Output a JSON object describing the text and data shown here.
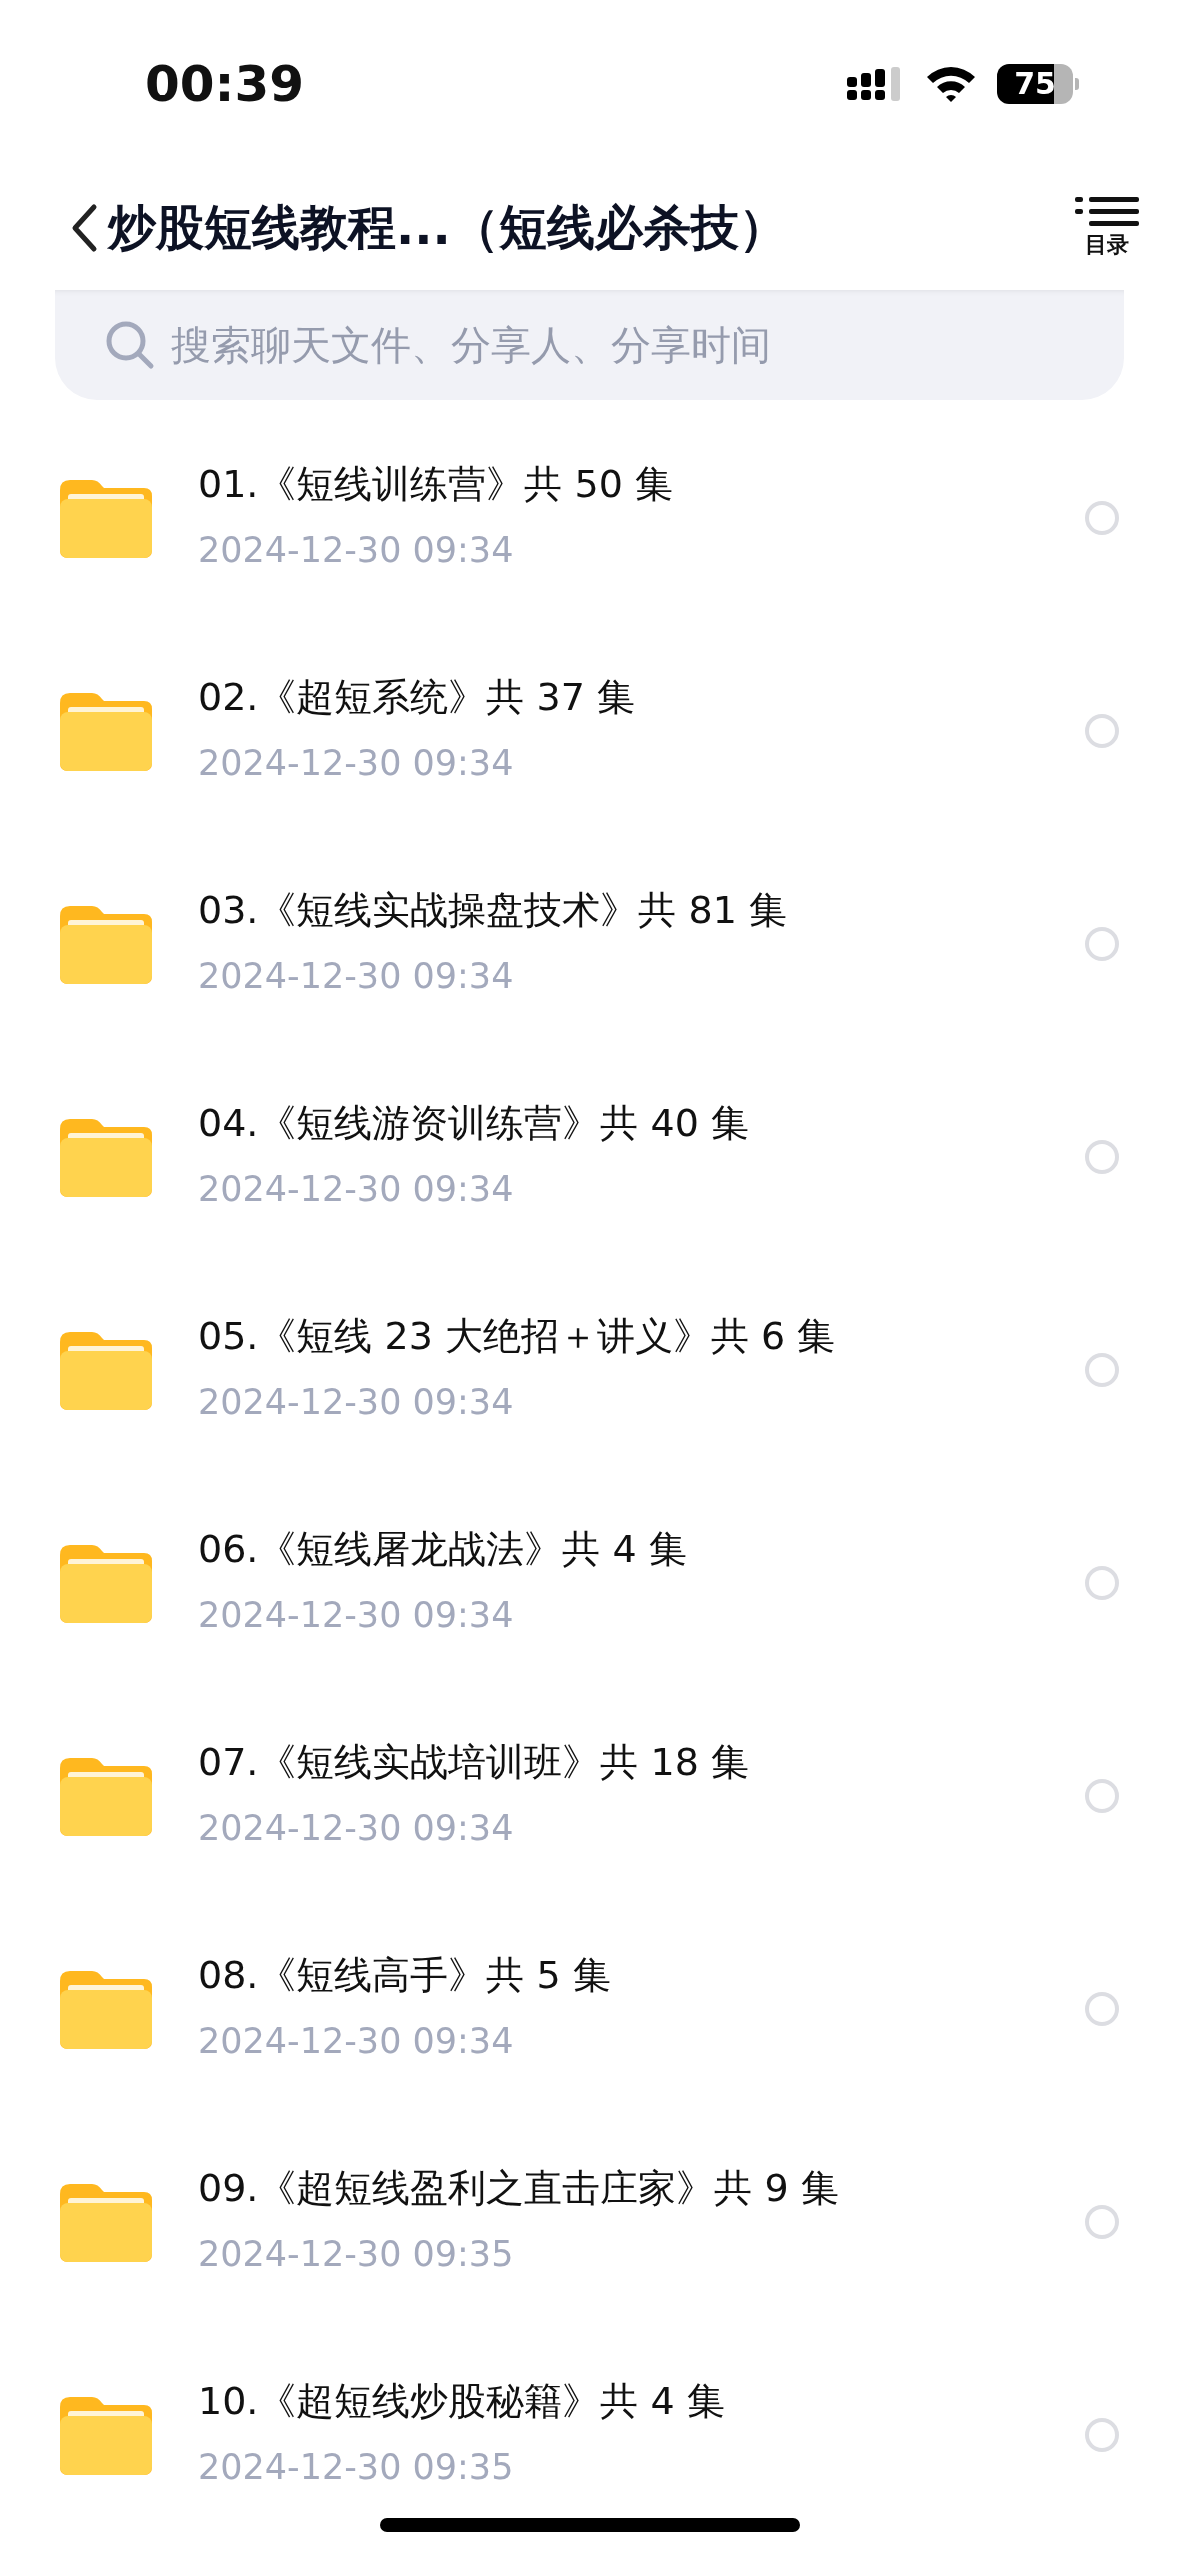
{
  "status_bar": {
    "time": "00:39",
    "battery": "75"
  },
  "header": {
    "title": "炒股短线教程...（短线必杀技）",
    "menu_label": "目录"
  },
  "search": {
    "placeholder": "搜索聊天文件、分享人、分享时间"
  },
  "files": [
    {
      "name": "01.《短线训练营》共 50 集",
      "date": "2024-12-30 09:34",
      "selected": false
    },
    {
      "name": "02.《超短系统》共 37 集",
      "date": "2024-12-30 09:34",
      "selected": false
    },
    {
      "name": "03.《短线实战操盘技术》共 81 集",
      "date": "2024-12-30 09:34",
      "selected": false
    },
    {
      "name": "04.《短线游资训练营》共 40 集",
      "date": "2024-12-30 09:34",
      "selected": false
    },
    {
      "name": "05.《短线 23 大绝招＋讲义》共 6 集",
      "date": "2024-12-30 09:34",
      "selected": false
    },
    {
      "name": "06.《短线屠龙战法》共 4 集",
      "date": "2024-12-30 09:34",
      "selected": false
    },
    {
      "name": "07.《短线实战培训班》共 18 集",
      "date": "2024-12-30 09:34",
      "selected": false
    },
    {
      "name": "08.《短线高手》共 5 集",
      "date": "2024-12-30 09:34",
      "selected": false
    },
    {
      "name": "09.《超短线盈利之直击庄家》共 9 集",
      "date": "2024-12-30 09:35",
      "selected": false
    },
    {
      "name": "10.《超短线炒股秘籍》共 4 集",
      "date": "2024-12-30 09:35",
      "selected": false
    }
  ]
}
